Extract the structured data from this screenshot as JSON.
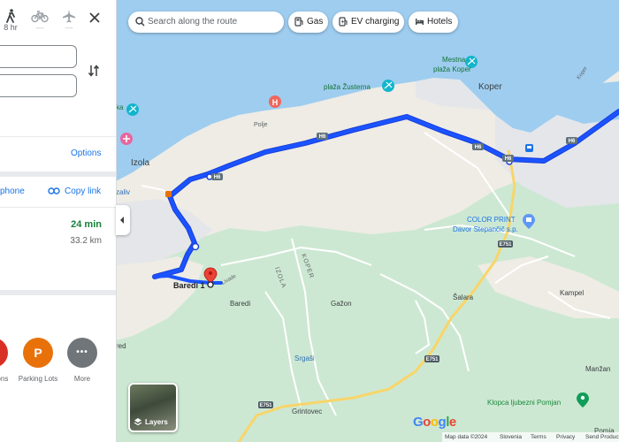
{
  "panel": {
    "modes": [
      {
        "name": "walking",
        "label": "8 hr"
      },
      {
        "name": "cycling",
        "label": "—"
      },
      {
        "name": "flight",
        "label": "—"
      }
    ],
    "options_label": "Options",
    "share_phone_label": "phone",
    "copy_link_label": "Copy link",
    "route": {
      "duration": "24 min",
      "distance": "33.2 km"
    },
    "nearby": [
      {
        "label": "ions",
        "color": "#d93025",
        "glyph": ""
      },
      {
        "label": "Parking Lots",
        "color": "#e8710a",
        "glyph": "P"
      },
      {
        "label": "More",
        "color": "#70757a",
        "glyph": "•••"
      }
    ]
  },
  "search": {
    "placeholder": "Search along the route"
  },
  "chips": [
    {
      "label": "Gas",
      "icon": "gas-pump-icon"
    },
    {
      "label": "EV charging",
      "icon": "ev-charging-icon"
    },
    {
      "label": "Hotels",
      "icon": "hotel-icon"
    }
  ],
  "map": {
    "labels": {
      "koper_city": "Koper",
      "mestna_line1": "Mestna",
      "mestna_line2": "plaža Koper",
      "zusterna": "plaža Žusterna",
      "izola": "Izola",
      "polje": "Polje",
      "zaliv": "zaliv",
      "ka": "ka",
      "color_print_line1": "COLOR PRINT",
      "color_print_line2": "Davor Stepančič s.p.",
      "baredi_destination": "Baredi 1",
      "baredi": "Baredi",
      "izola_vertical": "IZOLA",
      "koper_vertical": "KOPER",
      "gazon": "Gažon",
      "salara": "Šalara",
      "kampel": "Kampel",
      "srgasi": "Srgaši",
      "manzan": "Manžan",
      "grintovec": "Grintovec",
      "klopca": "Klopca ljubezni Pomjan",
      "pomj": "Pomja",
      "koper_road": "Koper",
      "livade": "Livade",
      "red": "red",
      "h6a": "H6",
      "h6b": "H6",
      "h6c": "H6",
      "h6d": "H6",
      "h6e": "H6",
      "e751a": "E751",
      "e751b": "E751",
      "e751c": "E751"
    },
    "colors": {
      "water": "#9ecdf0",
      "land": "#eeece5",
      "green": "#cde8d2",
      "urban": "#e4e6ea",
      "route": "#1a53ff",
      "route_outline": "#1a3fd6"
    },
    "layers_label": "Layers",
    "google_logo": "Google"
  },
  "footer": {
    "map_data": "Map data ©2024",
    "country": "Slovenia",
    "terms": "Terms",
    "privacy": "Privacy",
    "feedback": "Send Product"
  }
}
